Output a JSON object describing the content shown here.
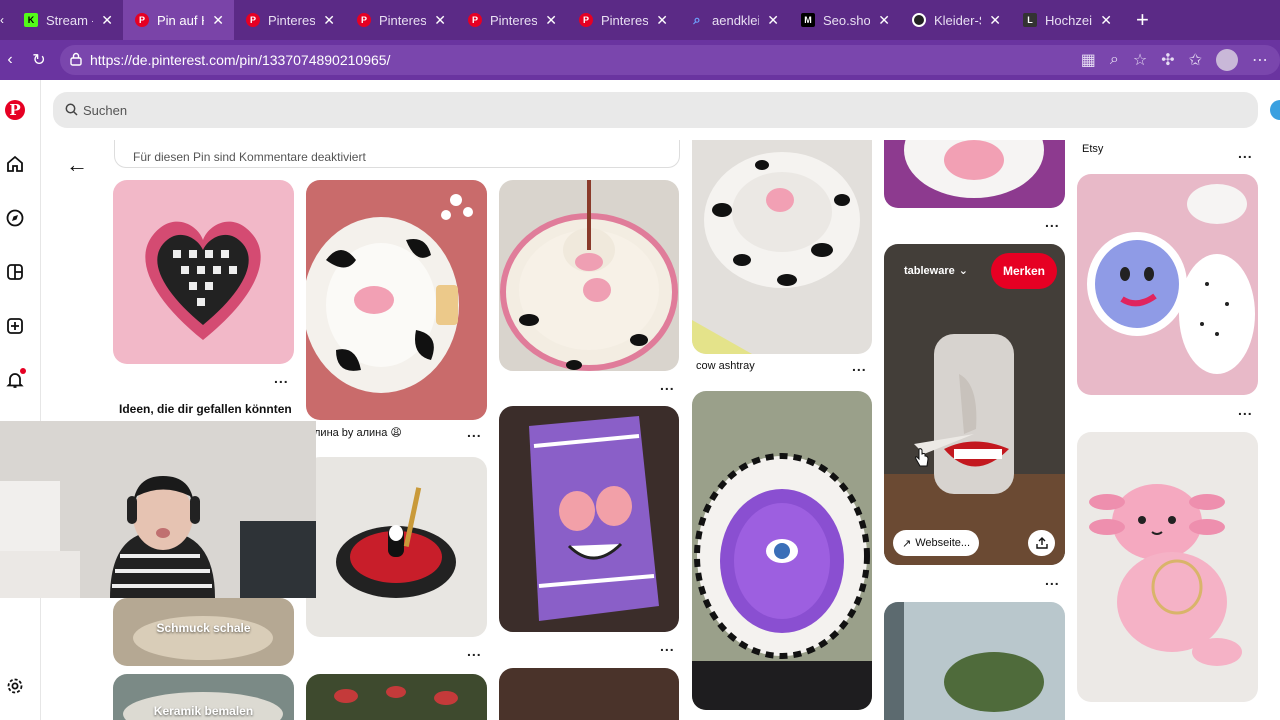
{
  "browser": {
    "tabs": [
      {
        "icon": "kick-icon",
        "title": "Stream - K"
      },
      {
        "icon": "pinterest-icon",
        "title": "Pin auf Ho",
        "active": true
      },
      {
        "icon": "pinterest-icon",
        "title": "Pinterest"
      },
      {
        "icon": "pinterest-icon",
        "title": "Pinterest"
      },
      {
        "icon": "pinterest-icon",
        "title": "Pinterest"
      },
      {
        "icon": "pinterest-icon",
        "title": "Pinterest"
      },
      {
        "icon": "search-icon",
        "title": "aendkleid"
      },
      {
        "icon": "medium-icon",
        "title": "Seo.shop"
      },
      {
        "icon": "kleider-icon",
        "title": "Kleider-Sa"
      },
      {
        "icon": "hochzeit-icon",
        "title": "Hochzeits"
      }
    ],
    "url": "https://de.pinterest.com/pin/1337074890210965/"
  },
  "search": {
    "placeholder": "Suchen"
  },
  "comments": {
    "disabled_text": "Für diesen Pin sind Kommentare deaktiviert"
  },
  "section": {
    "related_title": "Ideen, die dir gefallen könnten"
  },
  "pins": {
    "col2_caption": "лина by алина 😩",
    "col4_caption": "cow ashtray",
    "col6_caption": "Etsy",
    "schmuck": "Schmuck schale",
    "keramik": "Keramik bemalen",
    "hover_board": "tableware",
    "merken": "Merken",
    "website": "Webseite...",
    "more": "..."
  },
  "colors": {
    "pinterest_red": "#e60023",
    "browser_purple": "#5b2a86"
  }
}
